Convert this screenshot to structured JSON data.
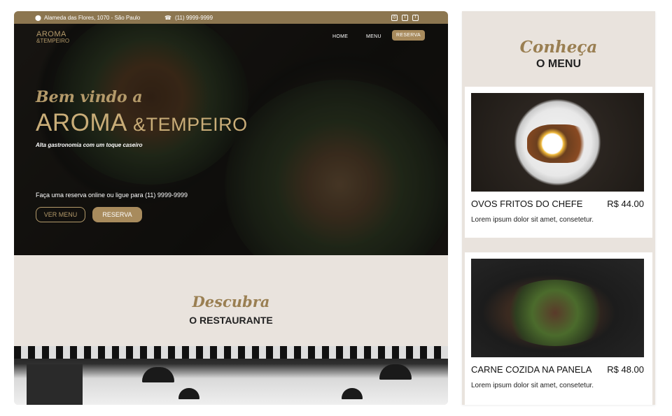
{
  "topbar": {
    "address": "Alameda das Flores, 1070 - São Paulo",
    "phone": "(11) 9999-9999",
    "social": [
      "instagram-icon",
      "twitter-icon",
      "facebook-icon"
    ]
  },
  "logo": {
    "line1": "AROMA",
    "line2": "&TEMPEIRO"
  },
  "nav": {
    "home": "HOME",
    "menu": "MENU",
    "reserva": "RESERVA"
  },
  "hero": {
    "welcome": "Bem vindo a",
    "brand_main": "AROMA",
    "brand_rest": "&TEMPEIRO",
    "tagline": "Alta gastronomia com um toque caseiro",
    "cta_text": "Faça uma reserva online ou ligue para (11) 9999-9999",
    "btn_menu": "VER MENU",
    "btn_reserva": "RESERVA"
  },
  "discover": {
    "script": "Descubra",
    "title": "O RESTAURANTE"
  },
  "menu_panel": {
    "script": "Conheça",
    "title": "O MENU",
    "items": [
      {
        "name": "OVOS FRITOS DO CHEFE",
        "price": "R$ 44.00",
        "desc": "Lorem ipsum dolor sit amet, consetetur."
      },
      {
        "name": "CARNE COZIDA NA PANELA",
        "price": "R$ 48.00",
        "desc": "Lorem ipsum dolor sit amet, consetetur."
      }
    ]
  },
  "colors": {
    "accent": "#a88b5d",
    "topbar": "#8c7650",
    "panel_bg": "#e9e3dd",
    "script": "#9a7f52"
  }
}
